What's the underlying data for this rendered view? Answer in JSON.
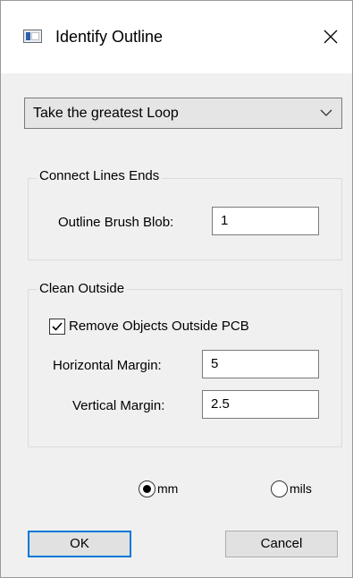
{
  "window": {
    "title": "Identify Outline",
    "icon": "app-window-icon",
    "close_icon": "close-icon"
  },
  "mode": {
    "selected": "Take the greatest Loop",
    "icon": "chevron-down-icon"
  },
  "connect_group": {
    "title": "Connect Lines Ends",
    "brush_label": "Outline Brush Blob:",
    "brush_value": "1"
  },
  "clean_group": {
    "title": "Clean Outside",
    "remove_label": "Remove Objects Outside PCB",
    "remove_checked": true,
    "h_margin_label": "Horizontal Margin:",
    "h_margin_value": "5",
    "v_margin_label": "Vertical Margin:",
    "v_margin_value": "2.5"
  },
  "units": {
    "mm_label": "mm",
    "mils_label": "mils",
    "selected": "mm"
  },
  "buttons": {
    "ok": "OK",
    "cancel": "Cancel"
  }
}
